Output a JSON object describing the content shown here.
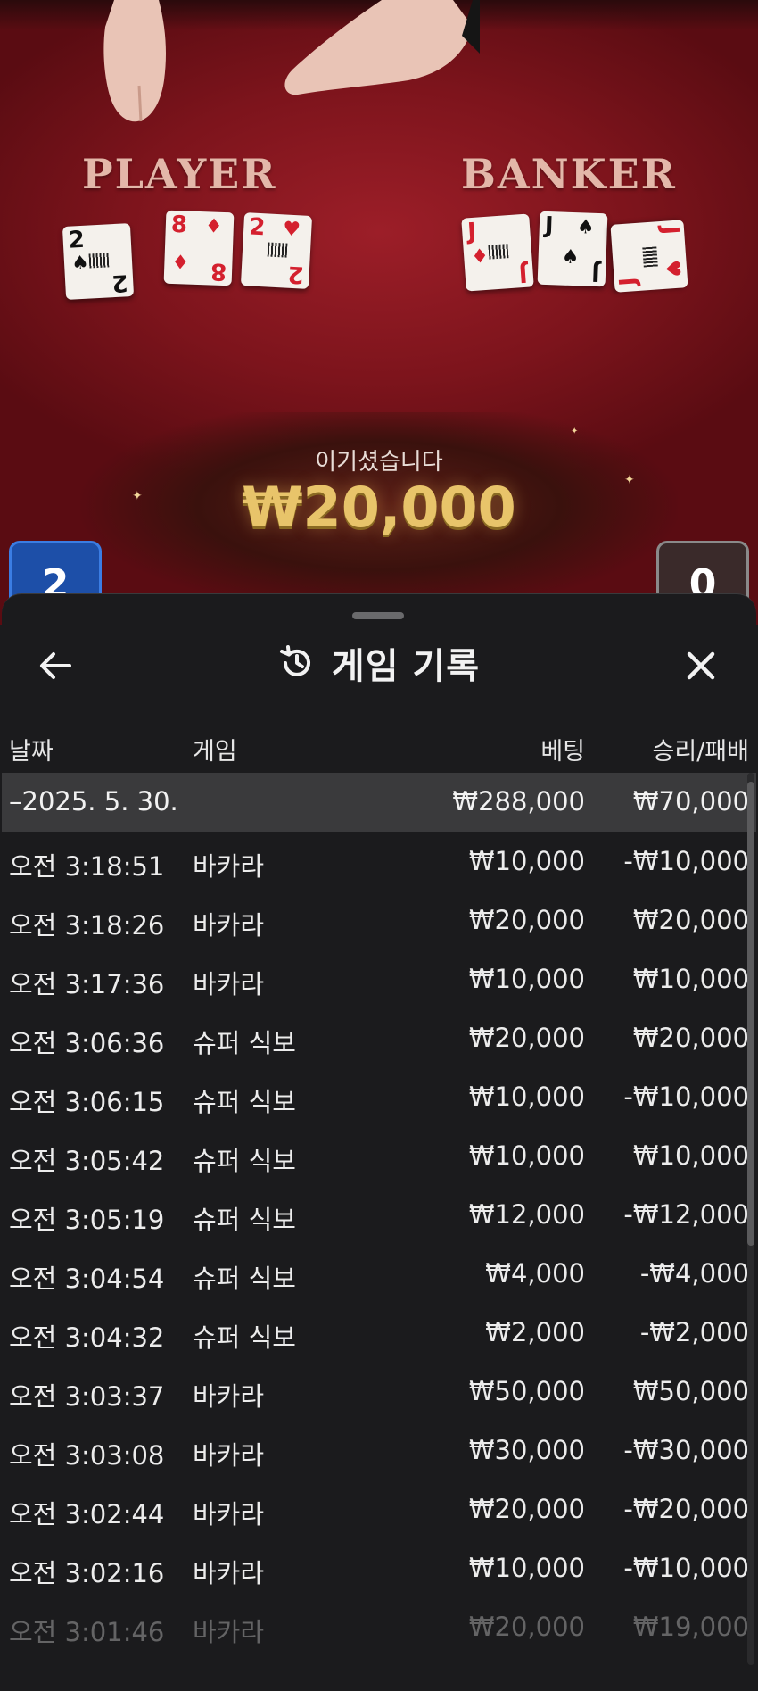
{
  "table": {
    "player_label": "PLAYER",
    "banker_label": "BANKER",
    "player_cards": [
      {
        "rank": "2",
        "suit": "♠",
        "color": "black"
      },
      {
        "rank": "8",
        "suit": "♦",
        "color": "red"
      },
      {
        "rank": "2",
        "suit": "♥",
        "color": "red"
      }
    ],
    "banker_cards": [
      {
        "rank": "J",
        "suit": "♦",
        "color": "red"
      },
      {
        "rank": "J",
        "suit": "♠",
        "color": "black"
      },
      {
        "rank": "J",
        "suit": "♥",
        "color": "red"
      }
    ],
    "player_score": "2",
    "banker_score": "0",
    "win_title": "이기셨습니다",
    "win_amount": "₩20,000"
  },
  "sheet": {
    "title": "게임 기록",
    "back_icon": "arrow-left-icon",
    "history_icon": "history-icon",
    "close_icon": "close-icon",
    "columns": {
      "date": "날짜",
      "game": "게임",
      "bet": "베팅",
      "result": "승리/패배"
    },
    "day_summary": {
      "date": "–2025. 5. 30.",
      "bet": "₩288,000",
      "result": "₩70,000"
    },
    "rows": [
      {
        "time": "오전 3:18:51",
        "game": "바카라",
        "bet": "₩10,000",
        "result": "-₩10,000"
      },
      {
        "time": "오전 3:18:26",
        "game": "바카라",
        "bet": "₩20,000",
        "result": "₩20,000"
      },
      {
        "time": "오전 3:17:36",
        "game": "바카라",
        "bet": "₩10,000",
        "result": "₩10,000"
      },
      {
        "time": "오전 3:06:36",
        "game": "슈퍼 식보",
        "bet": "₩20,000",
        "result": "₩20,000"
      },
      {
        "time": "오전 3:06:15",
        "game": "슈퍼 식보",
        "bet": "₩10,000",
        "result": "-₩10,000"
      },
      {
        "time": "오전 3:05:42",
        "game": "슈퍼 식보",
        "bet": "₩10,000",
        "result": "₩10,000"
      },
      {
        "time": "오전 3:05:19",
        "game": "슈퍼 식보",
        "bet": "₩12,000",
        "result": "-₩12,000"
      },
      {
        "time": "오전 3:04:54",
        "game": "슈퍼 식보",
        "bet": "₩4,000",
        "result": "-₩4,000"
      },
      {
        "time": "오전 3:04:32",
        "game": "슈퍼 식보",
        "bet": "₩2,000",
        "result": "-₩2,000"
      },
      {
        "time": "오전 3:03:37",
        "game": "바카라",
        "bet": "₩50,000",
        "result": "₩50,000"
      },
      {
        "time": "오전 3:03:08",
        "game": "바카라",
        "bet": "₩30,000",
        "result": "-₩30,000"
      },
      {
        "time": "오전 3:02:44",
        "game": "바카라",
        "bet": "₩20,000",
        "result": "-₩20,000"
      },
      {
        "time": "오전 3:02:16",
        "game": "바카라",
        "bet": "₩10,000",
        "result": "-₩10,000"
      },
      {
        "time": "오전 3:01:46",
        "game": "바카라",
        "bet": "₩20,000",
        "result": "₩19,000"
      }
    ]
  },
  "colors": {
    "table_felt": "#8f1a23",
    "sheet_bg": "#1b1b1d",
    "summary_row_bg": "#3a3a3c",
    "win_gold": "#e8c46a",
    "player_blue": "#1d4fa8"
  }
}
